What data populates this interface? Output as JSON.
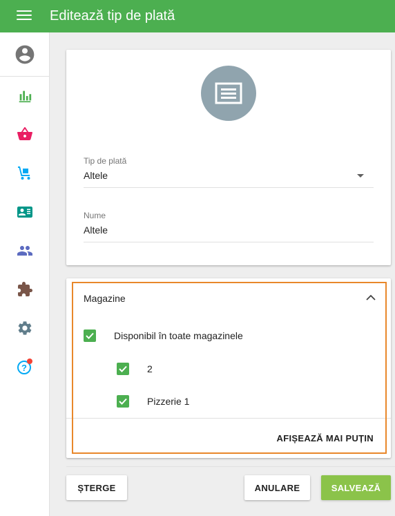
{
  "header": {
    "title": "Editează tip de plată"
  },
  "sidebar": {
    "icons": [
      "account-circle-icon",
      "bar-chart-icon",
      "shopping-basket-icon",
      "hand-truck-icon",
      "contact-card-icon",
      "people-icon",
      "extension-icon",
      "settings-icon",
      "help-icon"
    ],
    "colors": {
      "reports": "#4caf50",
      "basket": "#e91e63",
      "truck": "#03a9f4",
      "card": "#009688",
      "people": "#5c6bc0",
      "extension": "#795548",
      "settings": "#607d8b",
      "help": "#03a9f4",
      "notification": "#f44336"
    }
  },
  "form": {
    "payment_type": {
      "label": "Tip de plată",
      "value": "Altele"
    },
    "name": {
      "label": "Nume",
      "value": "Altele"
    }
  },
  "stores": {
    "title": "Magazine",
    "all_label": "Disponibil în toate magazinele",
    "items": [
      {
        "label": "2",
        "checked": true
      },
      {
        "label": "Pizzerie 1",
        "checked": true
      }
    ],
    "show_less": "AFIȘEAZĂ MAI PUȚIN"
  },
  "actions": {
    "delete": "ȘTERGE",
    "cancel": "ANULARE",
    "save": "SALVEAZĂ"
  },
  "colors": {
    "primary": "#4caf50",
    "save_button": "#8bc34a",
    "highlight": "#e8872a",
    "avatar_bg": "#90a4ae"
  }
}
